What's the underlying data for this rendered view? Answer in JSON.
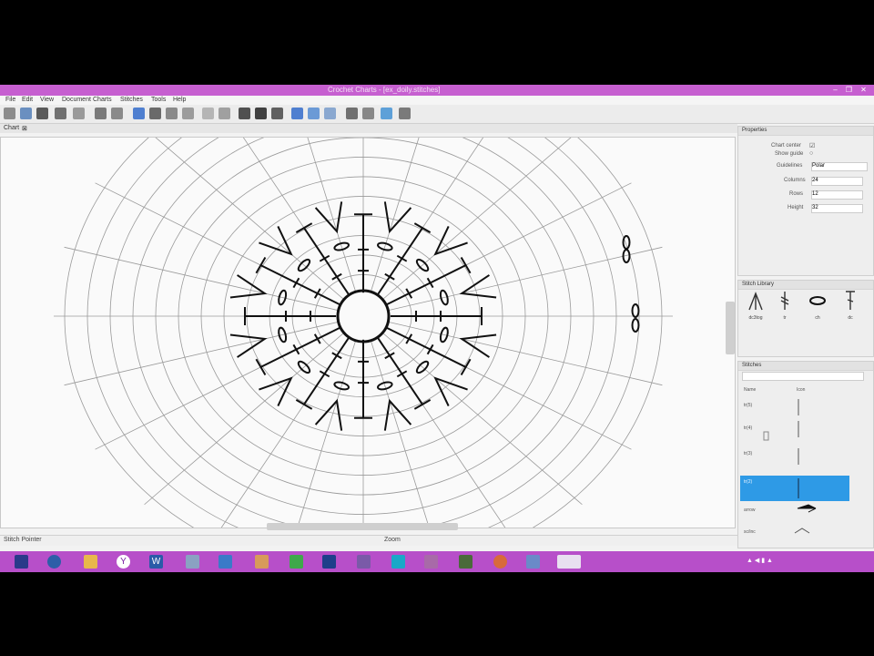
{
  "window": {
    "title": "Crochet Charts - [ex_doily.stitches]",
    "controls": [
      "–",
      "❐",
      "✕"
    ]
  },
  "menu": [
    "File",
    "Edit",
    "View",
    "Document",
    "Charts",
    "Stitches",
    "Tools",
    "Help"
  ],
  "tab": {
    "label": "Chart"
  },
  "statusbar": {
    "left": "Stitch Pointer",
    "center": "Zoom"
  },
  "dock": {
    "properties": {
      "title": "Properties",
      "checkbox1": "Chart center",
      "checkbox2": "Show guide",
      "fields": [
        {
          "label": "Guidelines",
          "value": "Polar"
        },
        {
          "label": "Columns",
          "value": "24"
        },
        {
          "label": "Rows",
          "value": "12"
        },
        {
          "label": "Height",
          "value": "32"
        }
      ]
    },
    "stitch_palette": {
      "title": "Stitch Library",
      "items": [
        {
          "name": "dc-cluster",
          "label": "dc3tog"
        },
        {
          "name": "treble",
          "label": "tr"
        },
        {
          "name": "chain",
          "label": "ch"
        },
        {
          "name": "double",
          "label": "dc"
        }
      ]
    },
    "library": {
      "title": "Stitches",
      "header": [
        "Name",
        "Icon"
      ],
      "rows": [
        {
          "name": "tr(5)"
        },
        {
          "name": "tr(4)"
        },
        {
          "name": "tr(3)"
        },
        {
          "name": "tr(2)",
          "selected": true
        },
        {
          "name": "arrow"
        },
        {
          "name": "sc/inc"
        }
      ]
    }
  },
  "accent_colors": {
    "titlebar": "#c65fd0",
    "taskbar": "#b74fc9",
    "selection": "#2e9ae6"
  },
  "taskbar": {
    "icons": [
      "explorer",
      "ie",
      "folder",
      "yahoo",
      "word",
      "notepad",
      "ie2",
      "tools",
      "paint",
      "photoshop",
      "stitch-app",
      "s-app",
      "font-app",
      "calculator",
      "chrome",
      "tool2",
      "crochet-app"
    ],
    "tray_time": "▲ ◀ ▮ ▲"
  }
}
